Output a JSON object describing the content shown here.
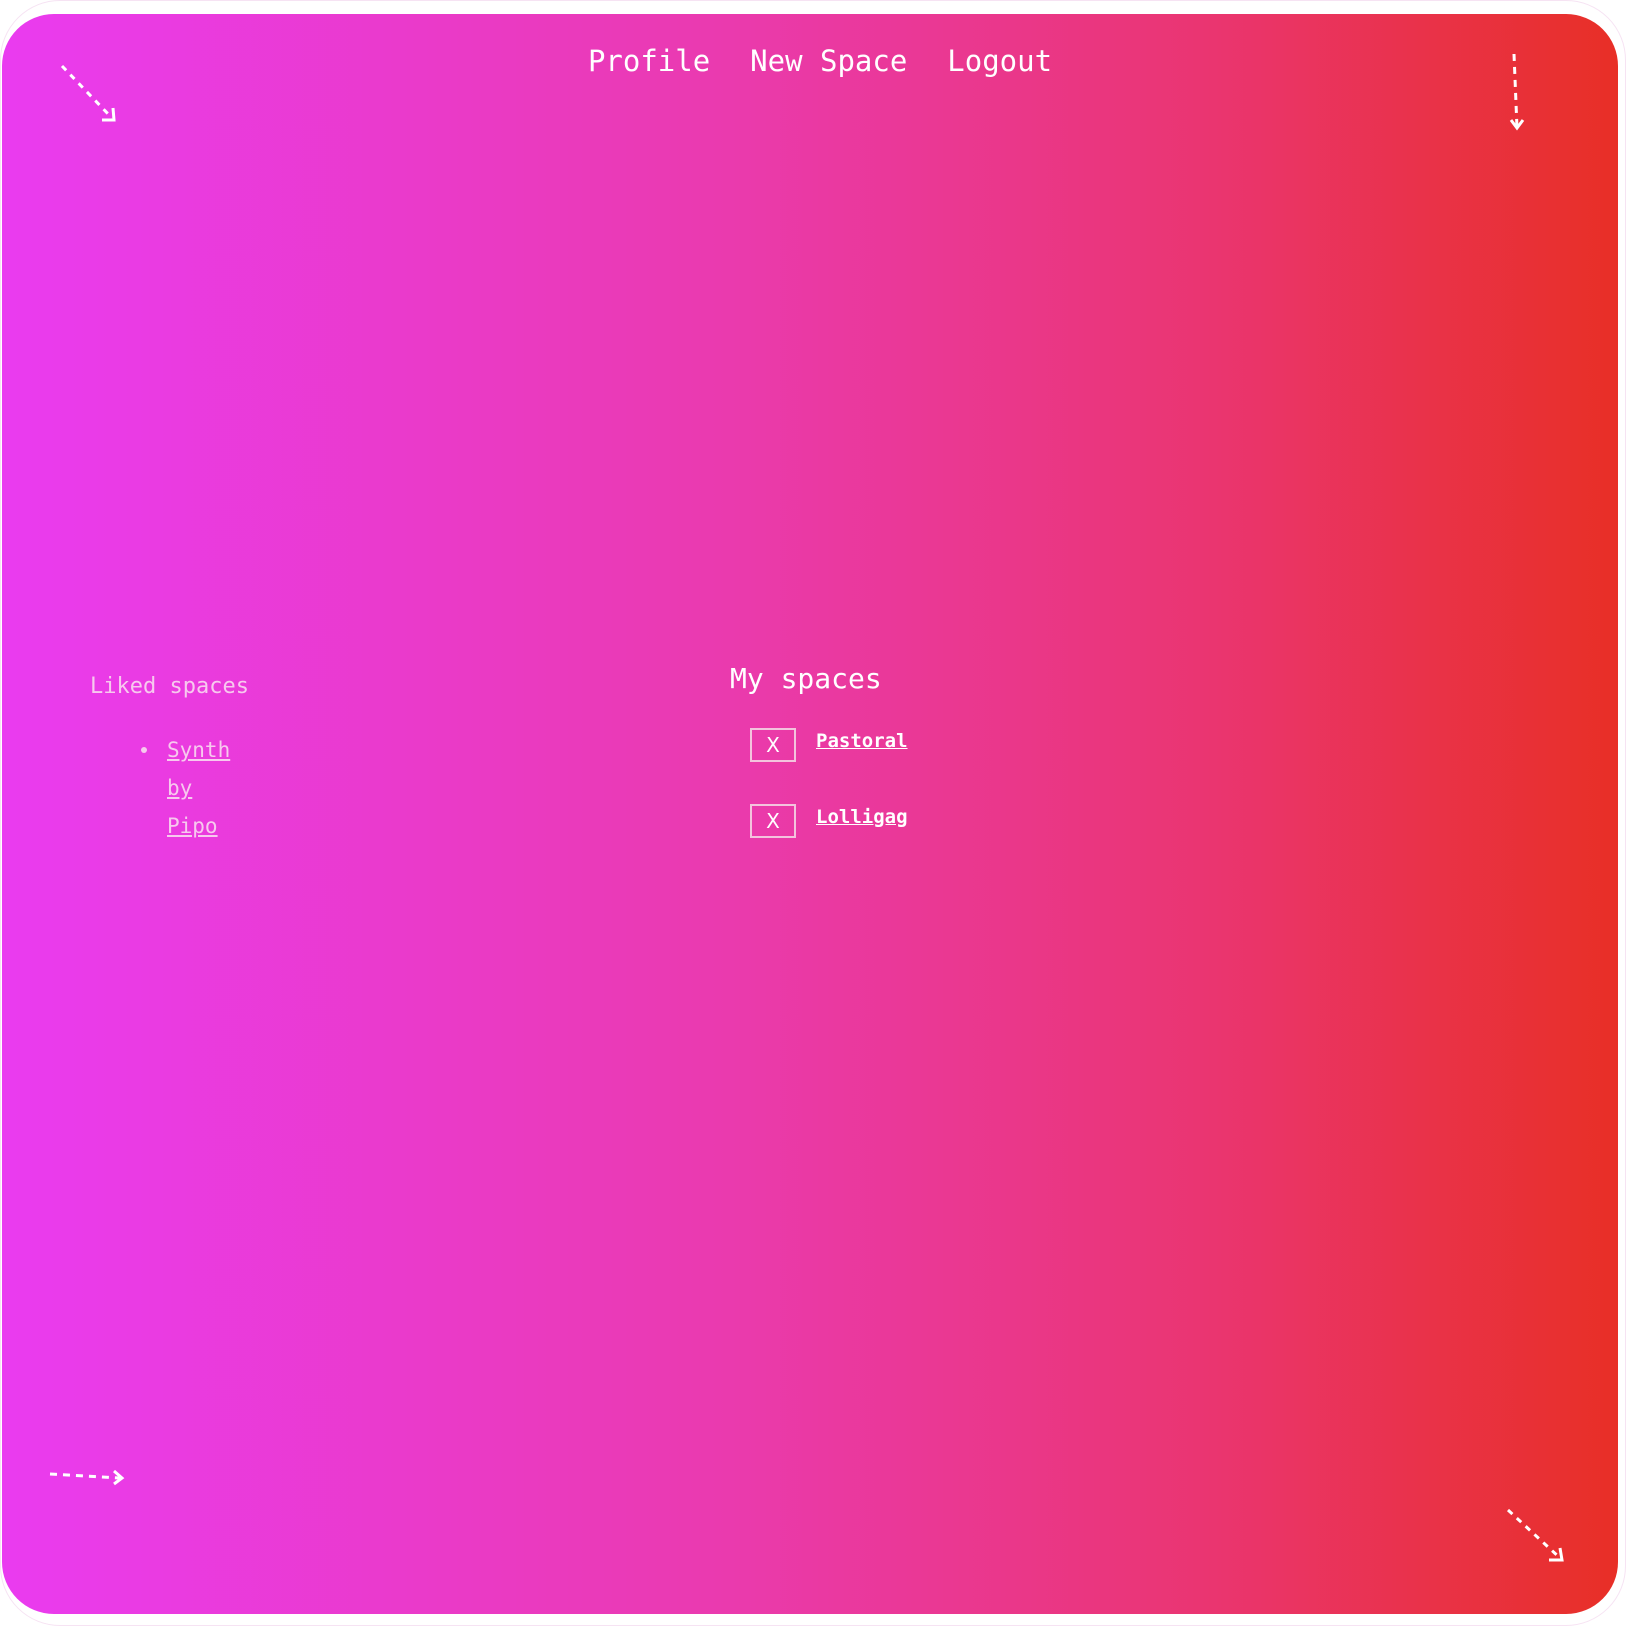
{
  "nav": {
    "items": [
      {
        "label": "Profile"
      },
      {
        "label": "New Space"
      },
      {
        "label": "Logout"
      }
    ]
  },
  "liked": {
    "heading": "Liked spaces",
    "items": [
      {
        "label": "Synth by Pipo"
      }
    ]
  },
  "my_spaces": {
    "heading": "My spaces",
    "delete_label": "X",
    "items": [
      {
        "label": "Pastoral"
      },
      {
        "label": "Lolligag"
      }
    ]
  },
  "colors": {
    "gradient_start": "#ea3bf0",
    "gradient_end": "#e82f26",
    "text": "#ffffff",
    "muted_text": "#f7c9ee"
  },
  "icons": [
    "arrow-down-right-icon",
    "arrow-down-icon",
    "arrow-right-icon",
    "arrow-down-right-icon"
  ]
}
